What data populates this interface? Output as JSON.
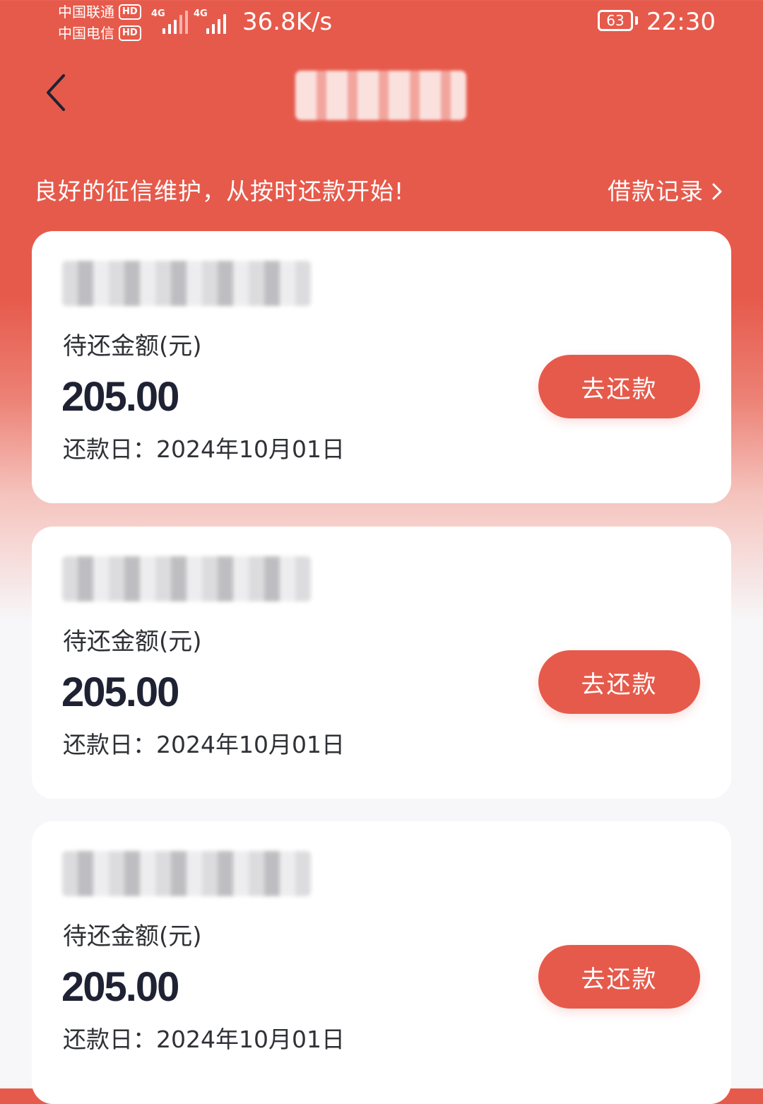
{
  "status_bar": {
    "carrier_1": "中国联通",
    "carrier_2": "中国电信",
    "hd_badge": "HD",
    "network_tag": "4G",
    "net_speed": "36.8K/s",
    "battery_level": "63",
    "time": "22:30"
  },
  "nav": {
    "back_icon": "chevron-left-icon"
  },
  "header": {
    "slogan": "良好的征信维护，从按时还款开始!",
    "loan_records_label": "借款记录",
    "loan_records_icon": "chevron-right-icon"
  },
  "loans": [
    {
      "amount_label": "待还金额(元)",
      "amount": "205.00",
      "due_date": "还款日：2024年10月01日",
      "button_label": "去还款"
    },
    {
      "amount_label": "待还金额(元)",
      "amount": "205.00",
      "due_date": "还款日：2024年10月01日",
      "button_label": "去还款"
    },
    {
      "amount_label": "待还金额(元)",
      "amount": "205.00",
      "due_date": "还款日：2024年10月01日",
      "button_label": "去还款"
    }
  ],
  "colors": {
    "brand_red": "#E65A4B",
    "text_dark": "#1E2233",
    "text_body": "#2F3136",
    "background": "#F7F7F9"
  }
}
